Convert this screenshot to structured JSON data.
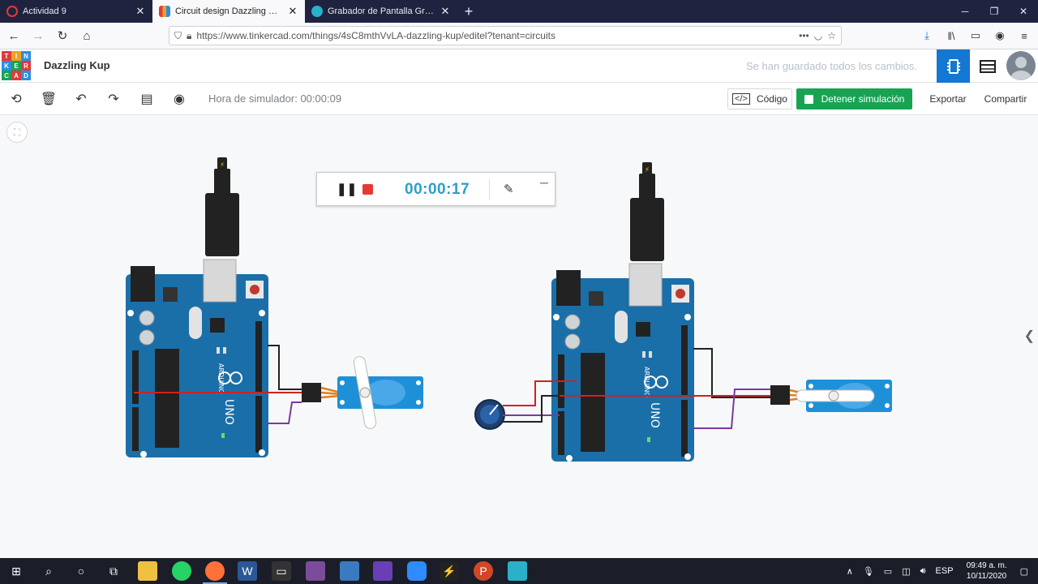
{
  "browser": {
    "tabs": [
      {
        "title": "Actividad 9",
        "active": false,
        "favicon_color": "#e03a3a"
      },
      {
        "title": "Circuit design Dazzling Kup | Tinkercad",
        "active": true,
        "favicon_color": "#2a8fe0"
      },
      {
        "title": "Grabador de Pantalla Gratis – Graba",
        "active": false,
        "favicon_color": "#2ab0c8"
      }
    ],
    "url": "https://www.tinkercad.com/things/4sC8mthVvLA-dazzling-kup/editel?tenant=circuits"
  },
  "app": {
    "logo_letters": [
      "TIN",
      "KER",
      "CAD"
    ],
    "design_name": "Dazzling Kup",
    "saved_status": "Se han guardado todos los cambios.",
    "accent_color": "#1477d2"
  },
  "toolbar": {
    "sim_time": "Hora de simulador: 00:00:09",
    "code_label": "Código",
    "stop_label": "Detener simulación",
    "export_label": "Exportar",
    "share_label": "Compartir"
  },
  "recorder": {
    "time": "00:00:17"
  },
  "boards": {
    "brand": "ARDUINO",
    "model": "UNO"
  },
  "taskbar": {
    "lang": "ESP",
    "time": "09:49 a. m.",
    "date": "10/11/2020"
  }
}
